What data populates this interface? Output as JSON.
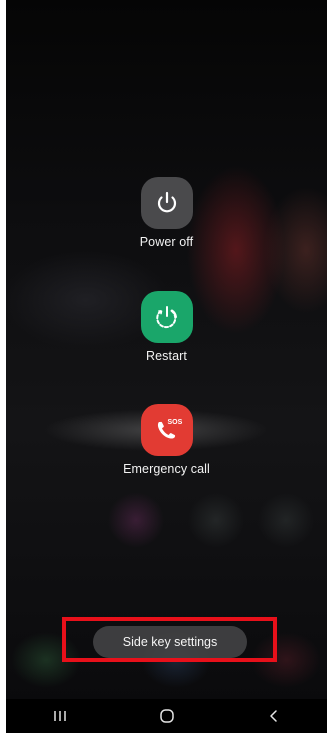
{
  "power_menu": {
    "power_off": {
      "label": "Power off",
      "icon": "power-icon",
      "color": "#4a4a4c"
    },
    "restart": {
      "label": "Restart",
      "icon": "restart-icon",
      "color": "#1aa66a"
    },
    "emergency": {
      "label": "Emergency call",
      "icon": "sos-phone-icon",
      "badge": "SOS",
      "color": "#e23b33"
    },
    "side_key_settings": {
      "label": "Side key settings"
    }
  },
  "highlight": {
    "color": "#e8101a"
  },
  "navbar": {
    "recents": {
      "icon": "recents-icon"
    },
    "home": {
      "icon": "home-icon"
    },
    "back": {
      "icon": "back-icon"
    }
  }
}
